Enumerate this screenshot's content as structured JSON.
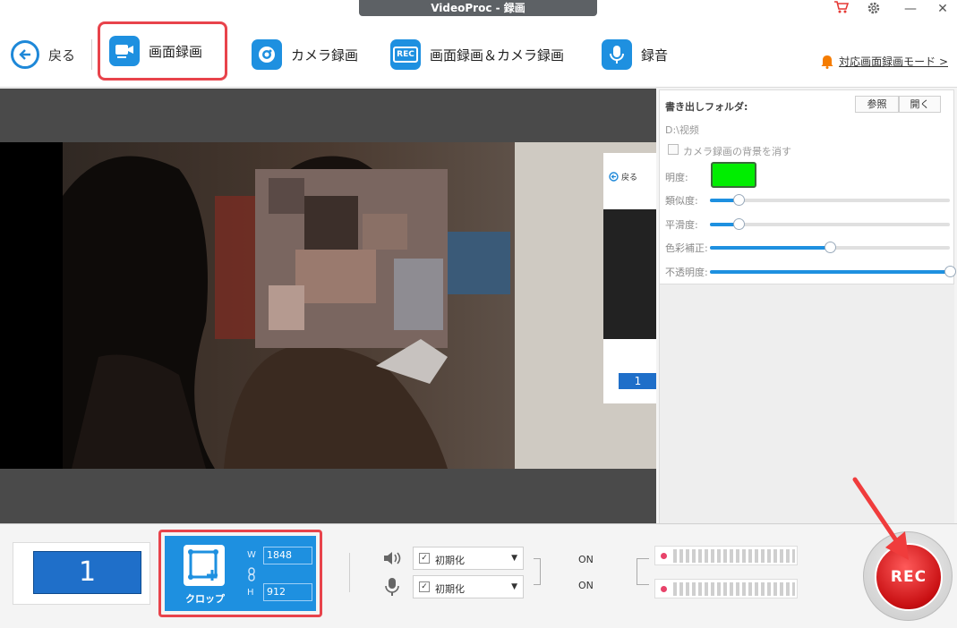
{
  "window": {
    "title": "VideoProc - 録画",
    "minimize": "—",
    "close": "✕"
  },
  "toolbar": {
    "back_label": "戻る",
    "modes": [
      {
        "label": "画面録画",
        "active": true
      },
      {
        "label": "カメラ録画",
        "active": false
      },
      {
        "label": "画面録画＆カメラ録画",
        "active": false,
        "icon_text": "REC"
      },
      {
        "label": "録音",
        "active": false
      }
    ],
    "notice_label": "対応画面録画モード >"
  },
  "preview": {
    "inner_back_label": "戻る",
    "inner_screen_number": "1"
  },
  "settings": {
    "export_folder_label": "書き出しフォルダ:",
    "browse_label": "参照",
    "open_label": "開く",
    "folder_path": "D:\\视频",
    "remove_bg_label": "カメラ録画の背景を消す",
    "brightness_label": "明度:",
    "key_color": "#00ee00",
    "sliders": [
      {
        "label": "類似度:",
        "value": 0.12
      },
      {
        "label": "平滑度:",
        "value": 0.12
      },
      {
        "label": "色彩補正:",
        "value": 0.5
      },
      {
        "label": "不透明度:",
        "value": 1.0
      }
    ]
  },
  "bottom": {
    "screen_number": "1",
    "crop_label": "クロップ",
    "width_letter": "W",
    "height_letter": "H",
    "width_value": "1848",
    "height_value": "912",
    "speaker_select": "初期化",
    "mic_select": "初期化",
    "speaker_on": "ON",
    "mic_on": "ON",
    "rec_label": "REC"
  },
  "colors": {
    "accent": "#1e90e0",
    "highlight": "#e8434b",
    "rec": "#c80f12"
  }
}
